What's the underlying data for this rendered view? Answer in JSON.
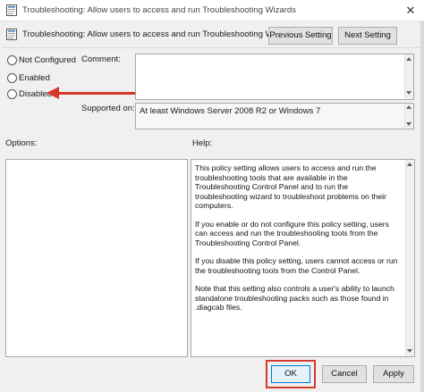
{
  "window": {
    "title": "Troubleshooting: Allow users to access and run Troubleshooting Wizards",
    "close_glyph": "✕"
  },
  "header": {
    "setting_name": "Troubleshooting: Allow users to access and run Troubleshooting Wizards",
    "previous_label": "Previous Setting",
    "next_label": "Next Setting"
  },
  "state": {
    "options": [
      {
        "label": "Not Configured",
        "selected": false
      },
      {
        "label": "Enabled",
        "selected": false
      },
      {
        "label": "Disabled",
        "selected": false
      }
    ]
  },
  "comment": {
    "label": "Comment:",
    "value": ""
  },
  "supported_on": {
    "label": "Supported on:",
    "value": "At least Windows Server 2008 R2 or Windows 7"
  },
  "options_panel": {
    "label": "Options:"
  },
  "help_panel": {
    "label": "Help:",
    "paragraphs": [
      "This policy setting allows users to access and run the troubleshooting tools that are available in the Troubleshooting Control Panel and to run the troubleshooting wizard to troubleshoot problems on their computers.",
      "If you enable or do not configure this policy setting, users can access and run the troubleshooting tools from the Troubleshooting Control Panel.",
      "If you disable this policy setting, users cannot access or run the troubleshooting tools from the Control Panel.",
      "Note that this setting also controls a user's ability to launch standalone troubleshooting packs such as those found in .diagcab files."
    ]
  },
  "footer": {
    "ok_label": "OK",
    "cancel_label": "Cancel",
    "apply_label": "Apply"
  },
  "annotations": {
    "arrow_color": "#d8382a",
    "highlight_color": "#d23a2a"
  },
  "icons": {
    "policy": "policy-document-icon"
  }
}
